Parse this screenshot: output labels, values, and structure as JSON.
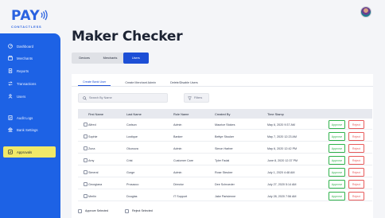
{
  "brand": {
    "name": "PAY",
    "tagline": "CONTACTLESS"
  },
  "page": {
    "title": "Maker Checker"
  },
  "sidebar": {
    "items": [
      {
        "label": "Dashboard",
        "icon": "dashboard-icon"
      },
      {
        "label": "Merchants",
        "icon": "merchants-icon"
      },
      {
        "label": "Reports",
        "icon": "reports-icon"
      },
      {
        "label": "Transactions",
        "icon": "transactions-icon"
      },
      {
        "label": "Users",
        "icon": "users-icon"
      },
      {
        "label": "Audit Logs",
        "icon": "audit-logs-icon"
      },
      {
        "label": "Bank Settings",
        "icon": "bank-settings-icon"
      },
      {
        "label": "Approvals",
        "icon": "approvals-icon",
        "active": true
      }
    ]
  },
  "segments": [
    {
      "label": "Devices"
    },
    {
      "label": "Merchants"
    },
    {
      "label": "Users",
      "active": true
    }
  ],
  "tabs": [
    {
      "label": "Create Bank User",
      "active": true
    },
    {
      "label": "Create Merchant Admin"
    },
    {
      "label": "Delete/Disable Users"
    }
  ],
  "search": {
    "placeholder": "Search By Name",
    "value": ""
  },
  "filter": {
    "label": "Filters"
  },
  "table": {
    "headers": [
      "First Name",
      "Last Name",
      "Role Name",
      "Created By",
      "Time Stamp"
    ],
    "rows": [
      [
        "Alfred",
        "Carlson",
        "Admin",
        "Maurice Stokes",
        "May 6, 2020 9:37 AM"
      ],
      [
        "Sophie",
        "Lustique",
        "Banker",
        "Bettye Stouker",
        "May 7, 2020 12:23 AM"
      ],
      [
        "Zuna",
        "Okunuva",
        "Admin",
        "Simon Harber",
        "May 6, 2020 12:42 PM"
      ],
      [
        "Amy",
        "Crist",
        "Customer Care",
        "Tyler Fadal",
        "June 8, 2020 12:37 PM"
      ],
      [
        "Simeral",
        "Gorge",
        "Admin",
        "Rose Steuber",
        "July 1, 2020 4:48 AM"
      ],
      [
        "Georgiana",
        "Prosacco",
        "Director",
        "Dee Schroeder",
        "July 27, 2020 5:14 AM"
      ],
      [
        "Merlin",
        "Douglas",
        "IT Support",
        "Jake Parisienne",
        "July 28, 2020 7:56 AM"
      ]
    ],
    "approve_label": "Approve",
    "reject_label": "Reject"
  },
  "bulk": {
    "approve_label": "Approve Selected",
    "reject_label": "Reject Selected"
  },
  "colors": {
    "primary": "#1d62e5",
    "accent_yellow": "#f1e968",
    "approve": "#2fb24a",
    "reject": "#e85a5a"
  }
}
